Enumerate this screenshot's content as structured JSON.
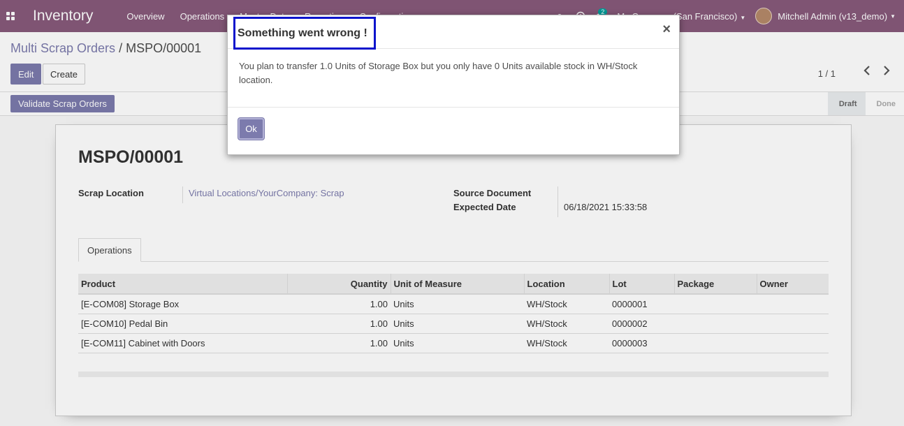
{
  "navbar": {
    "brand": "Inventory",
    "menu": [
      "Overview",
      "Operations",
      "Master Data",
      "Reporting",
      "Configuration"
    ],
    "chat_badge": "2",
    "company": "My Company (San Francisco)",
    "user": "Mitchell Admin (v13_demo)"
  },
  "control": {
    "breadcrumb_parent": "Multi Scrap Orders",
    "breadcrumb_sep": "/",
    "breadcrumb_current": "MSPO/00001",
    "edit_label": "Edit",
    "create_label": "Create",
    "pager": "1 / 1"
  },
  "statusbar": {
    "validate_label": "Validate Scrap Orders",
    "steps": [
      "Draft",
      "Done"
    ]
  },
  "form": {
    "title": "MSPO/00001",
    "scrap_location_label": "Scrap Location",
    "scrap_location_value": "Virtual Locations/YourCompany: Scrap",
    "source_document_label": "Source Document",
    "expected_date_label": "Expected Date",
    "expected_date_value": "06/18/2021 15:33:58",
    "tab_label": "Operations",
    "columns": [
      "Product",
      "Quantity",
      "Unit of Measure",
      "Location",
      "Lot",
      "Package",
      "Owner"
    ],
    "rows": [
      [
        "[E-COM08] Storage Box",
        "1.00",
        "Units",
        "WH/Stock",
        "0000001",
        "",
        ""
      ],
      [
        "[E-COM10] Pedal Bin",
        "1.00",
        "Units",
        "WH/Stock",
        "0000002",
        "",
        ""
      ],
      [
        "[E-COM11] Cabinet with Doors",
        "1.00",
        "Units",
        "WH/Stock",
        "0000003",
        "",
        ""
      ]
    ]
  },
  "dialog": {
    "title": "Something went wrong !",
    "close": "×",
    "message": "You plan to transfer 1.0 Units of Storage Box but you only have 0 Units available stock in WH/Stock location.",
    "ok_label": "Ok"
  },
  "colors": {
    "brand": "#875a7b",
    "primary": "#7c7bad",
    "highlight_box": "#0a14cc"
  }
}
